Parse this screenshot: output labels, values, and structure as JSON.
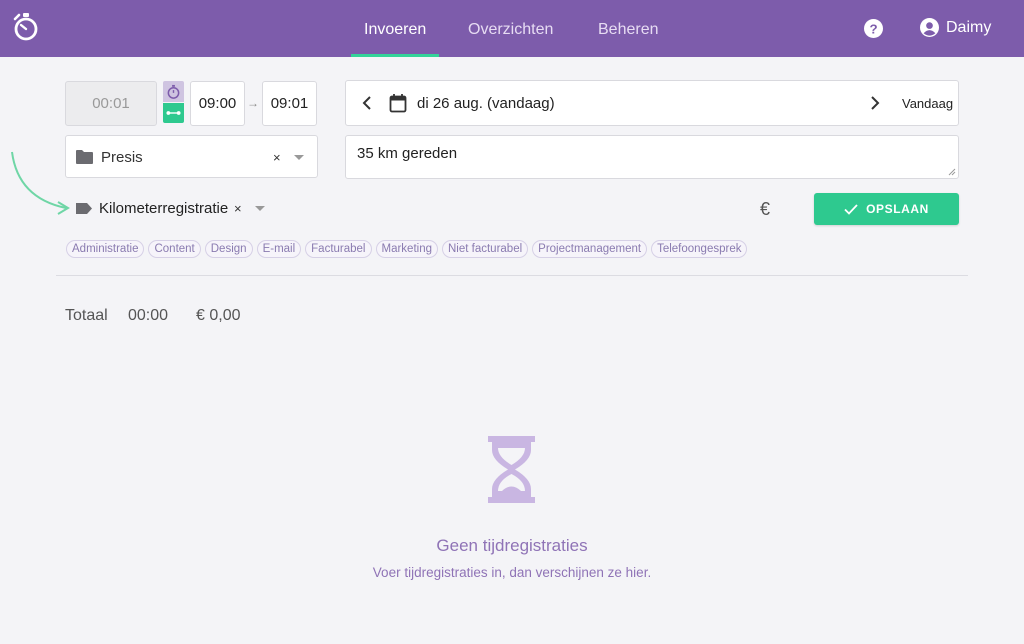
{
  "nav": {
    "items": [
      {
        "label": "Invoeren",
        "active": true
      },
      {
        "label": "Overzichten",
        "active": false
      },
      {
        "label": "Beheren",
        "active": false
      }
    ],
    "user_name": "Daimy"
  },
  "entry": {
    "duration_placeholder": "00:01",
    "start_time": "09:00",
    "end_time": "09:01",
    "date_label": "di 26 aug. (vandaag)",
    "today_label": "Vandaag",
    "project": "Presis",
    "description": "35 km gereden",
    "selected_tag": "Kilometerregistratie",
    "save_label": "OPSLAAN"
  },
  "tags": [
    "Administratie",
    "Content",
    "Design",
    "E-mail",
    "Facturabel",
    "Marketing",
    "Niet facturabel",
    "Projectmanagement",
    "Telefoongesprek"
  ],
  "totals": {
    "label": "Totaal",
    "time": "00:00",
    "money": "€ 0,00"
  },
  "empty": {
    "title": "Geen tijdregistraties",
    "subtitle": "Voer tijdregistraties in, dan verschijnen ze hier."
  },
  "colors": {
    "brand": "#7d5cab",
    "accent": "#2ec98f",
    "muted": "#8f73b6"
  },
  "icons": [
    "stopwatch-logo-icon",
    "help-icon",
    "user-icon",
    "timer-icon",
    "range-icon",
    "calendar-icon",
    "folder-icon",
    "tag-icon",
    "euro-icon",
    "check-icon",
    "hourglass-icon"
  ]
}
